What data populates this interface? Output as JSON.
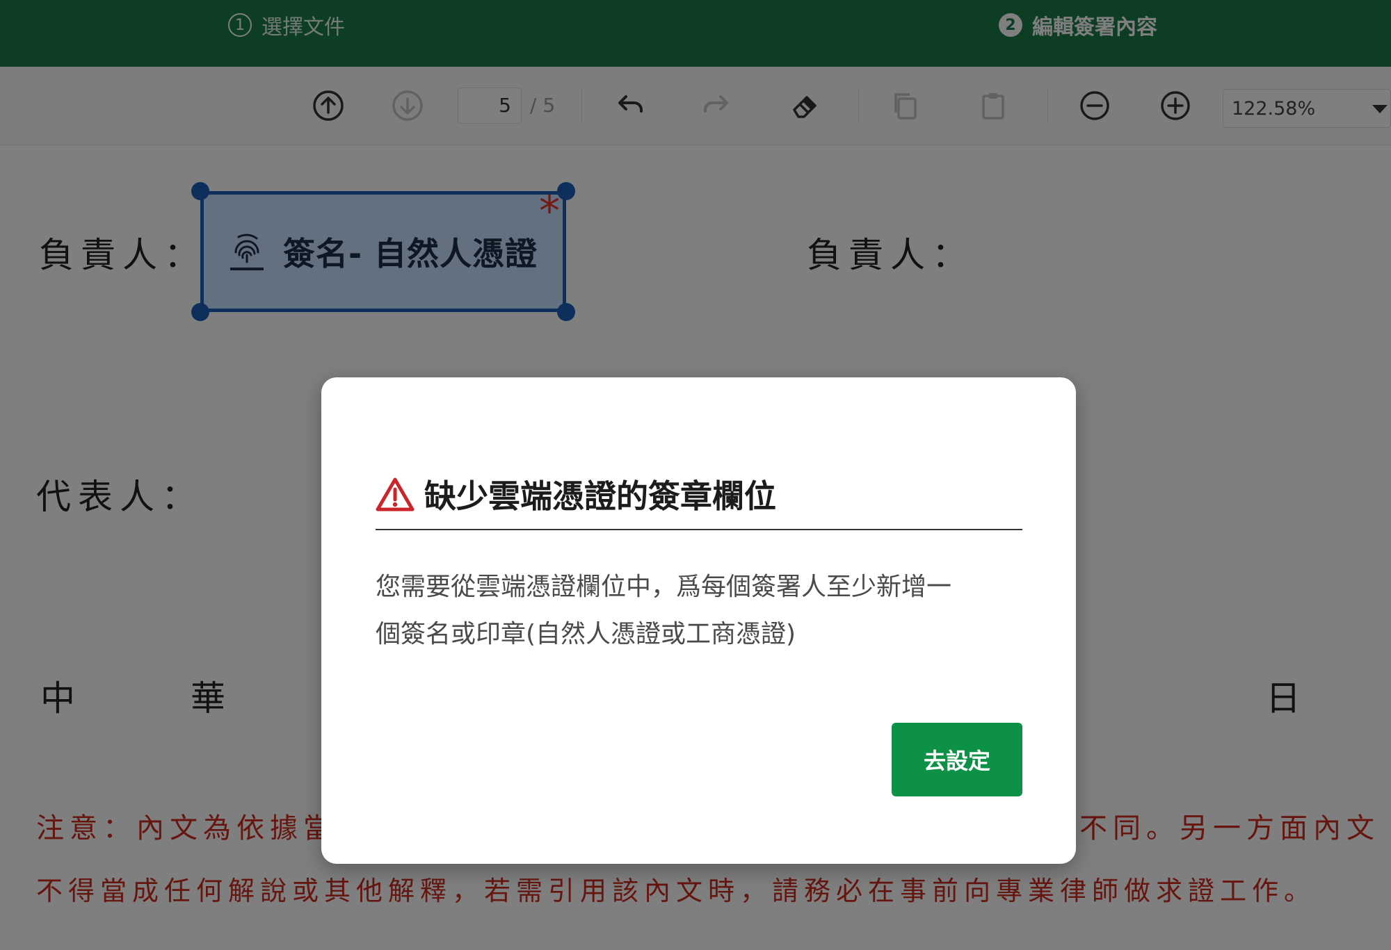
{
  "steps": [
    {
      "number": "1",
      "label": "選擇文件"
    },
    {
      "number": "2",
      "label": "編輯簽署內容"
    }
  ],
  "toolbar": {
    "current_page": "5",
    "total_pages": "/ 5",
    "zoom": "122.58%",
    "icons": [
      "arrow-up-circle-icon",
      "arrow-down-circle-icon",
      "undo-icon",
      "redo-icon",
      "eraser-icon",
      "copy-icon",
      "paste-icon",
      "zoom-out-icon",
      "zoom-in-icon",
      "chevron-down-icon"
    ]
  },
  "document": {
    "left_responsible": "負責人：",
    "right_responsible": "負責人：",
    "representative": "代表人：",
    "date_char_1": "中",
    "date_char_2": "華",
    "date_char_day": "日",
    "notice_line1_left": "注意：內文為依據當",
    "notice_line1_right": "不同。另一方面內文",
    "notice_line2": "不得當成任何解說或其他解釋，若需引用該內文時，請務必在事前向專業律師做求證工作。",
    "signature_field": {
      "label": "簽名- 自然人憑證",
      "required_mark": "*",
      "icon": "fingerprint-icon",
      "fill_color": "#c7e0ff",
      "border_color": "#1d5fb6"
    }
  },
  "modal": {
    "title": "缺少雲端憑證的簽章欄位",
    "icon": "warning-icon",
    "icon_color": "#c9252a",
    "body_line1": "您需要從雲端憑證欄位中，爲每個簽署人至少新增一",
    "body_line2": "個簽名或印章(自然人憑證或工商憑證)",
    "button_label": "去設定",
    "button_color": "#0c9146"
  },
  "theme": {
    "header_green": "#1a7a46",
    "notice_red": "#cc2a1f"
  }
}
